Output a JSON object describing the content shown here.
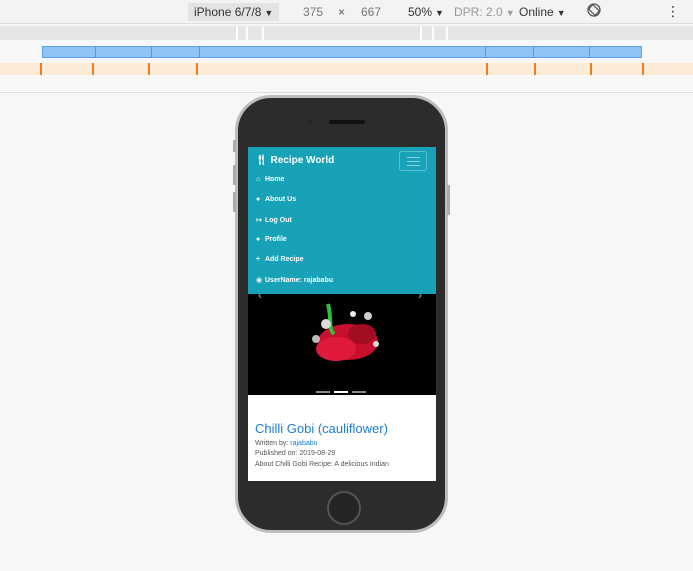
{
  "devtools": {
    "device": "iPhone 6/7/8",
    "width": "375",
    "times": "×",
    "height": "667",
    "zoom": "50%",
    "dpr": "DPR: 2.0",
    "network": "Online"
  },
  "app": {
    "brand": "Recipe World",
    "nav": [
      {
        "label": "Home",
        "icon": "home-icon"
      },
      {
        "label": "About Us",
        "icon": "users-icon"
      },
      {
        "label": "Log Out",
        "icon": "logout-icon"
      },
      {
        "label": "Profile",
        "icon": "user-icon"
      },
      {
        "label": "Add Recipe",
        "icon": "plus-icon"
      },
      {
        "label": "UserName: rajababu",
        "icon": "user-circle-icon"
      }
    ]
  },
  "recipe": {
    "title": "Chilli Gobi (cauliflower)",
    "written_by_label": "Written by:",
    "author": "rajababu",
    "published": "Published on: 2019-08-29",
    "description": "About Chilli Gobi Recipe: A delicious Indian"
  },
  "colors": {
    "navbar": "#17a2b8",
    "link": "#1a7ed8"
  }
}
